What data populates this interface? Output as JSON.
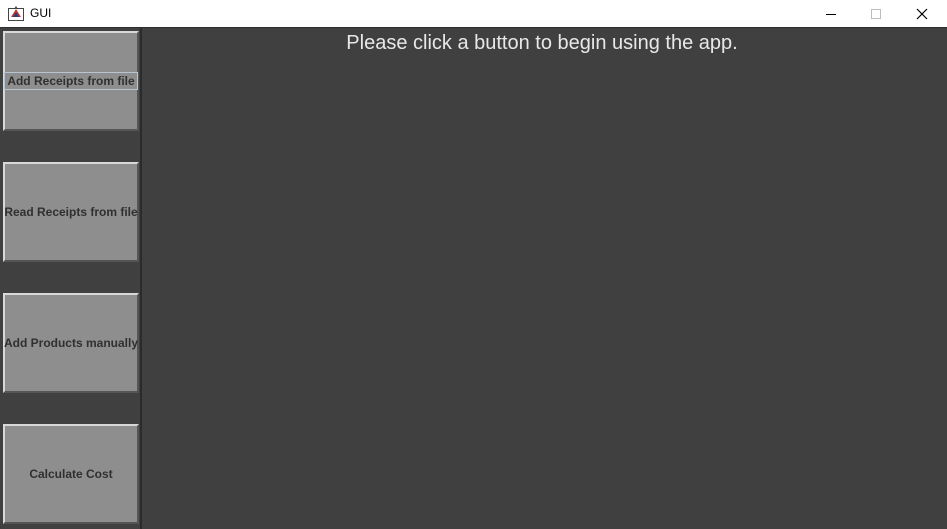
{
  "window": {
    "title": "GUI",
    "icon": "java-app-icon",
    "controls": {
      "minimize": "minimize-icon",
      "maximize": "maximize-icon",
      "close": "close-icon"
    }
  },
  "sidebar": {
    "buttons": [
      {
        "label": "Add Receipts from file"
      },
      {
        "label": "Read Receipts from file"
      },
      {
        "label": "Add Products manually"
      },
      {
        "label": "Calculate Cost"
      }
    ]
  },
  "main": {
    "message": "Please click a button to begin using the app."
  },
  "colors": {
    "background": "#404040",
    "button": "#8e8e8e",
    "button_text": "#303030",
    "message_text": "#e8e8e8"
  }
}
